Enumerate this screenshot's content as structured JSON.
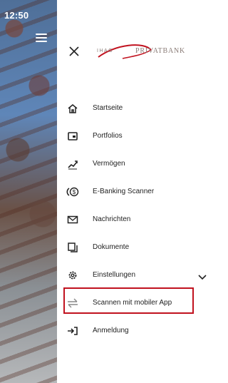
{
  "status_bar": {
    "time": "12:50"
  },
  "drawer": {
    "logo": {
      "left_text": "IHAG",
      "right_text": "PRIVATBANK",
      "accent_color": "#c1121f"
    },
    "menu": {
      "items": [
        {
          "label": "Startseite",
          "icon": "home-icon"
        },
        {
          "label": "Portfolios",
          "icon": "wallet-icon"
        },
        {
          "label": "Vermögen",
          "icon": "chart-trend-icon"
        },
        {
          "label": "E-Banking Scanner",
          "icon": "currency-scan-icon"
        },
        {
          "label": "Nachrichten",
          "icon": "mail-icon"
        },
        {
          "label": "Dokumente",
          "icon": "documents-icon"
        },
        {
          "label": "Einstellungen",
          "icon": "gear-icon"
        },
        {
          "label": "Scannen mit mobiler App",
          "icon": "swap-arrows-icon"
        },
        {
          "label": "Anmeldung",
          "icon": "login-icon"
        }
      ]
    }
  },
  "colors": {
    "highlight_border": "#c1121f",
    "text": "#222222"
  }
}
